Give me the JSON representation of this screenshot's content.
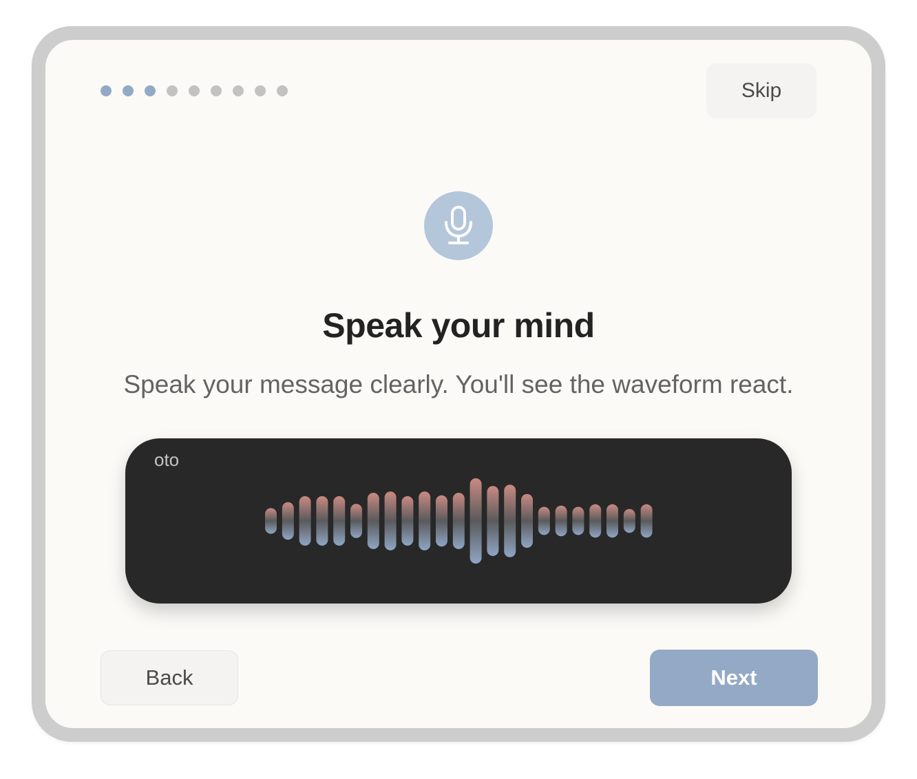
{
  "progress": {
    "total_steps": 9,
    "completed_steps": 3,
    "active_color": "#93aac6",
    "inactive_color": "#c2c2c0"
  },
  "header": {
    "skip_label": "Skip"
  },
  "hero": {
    "icon": "microphone-icon",
    "icon_bg_color": "#b4c6da",
    "title": "Speak your mind",
    "subtitle": "Speak your message clearly. You'll see the waveform react."
  },
  "waveform": {
    "label": "oto",
    "bar_levels": [
      0.3,
      0.44,
      0.58,
      0.58,
      0.58,
      0.4,
      0.66,
      0.69,
      0.58,
      0.69,
      0.6,
      0.66,
      1.0,
      0.82,
      0.85,
      0.63,
      0.33,
      0.36,
      0.33,
      0.39,
      0.39,
      0.28,
      0.39
    ],
    "gradient_top_color": "#c98a82",
    "gradient_bottom_color": "#8fa6c4"
  },
  "footer": {
    "back_label": "Back",
    "next_label": "Next",
    "next_color": "#94a9c5"
  }
}
